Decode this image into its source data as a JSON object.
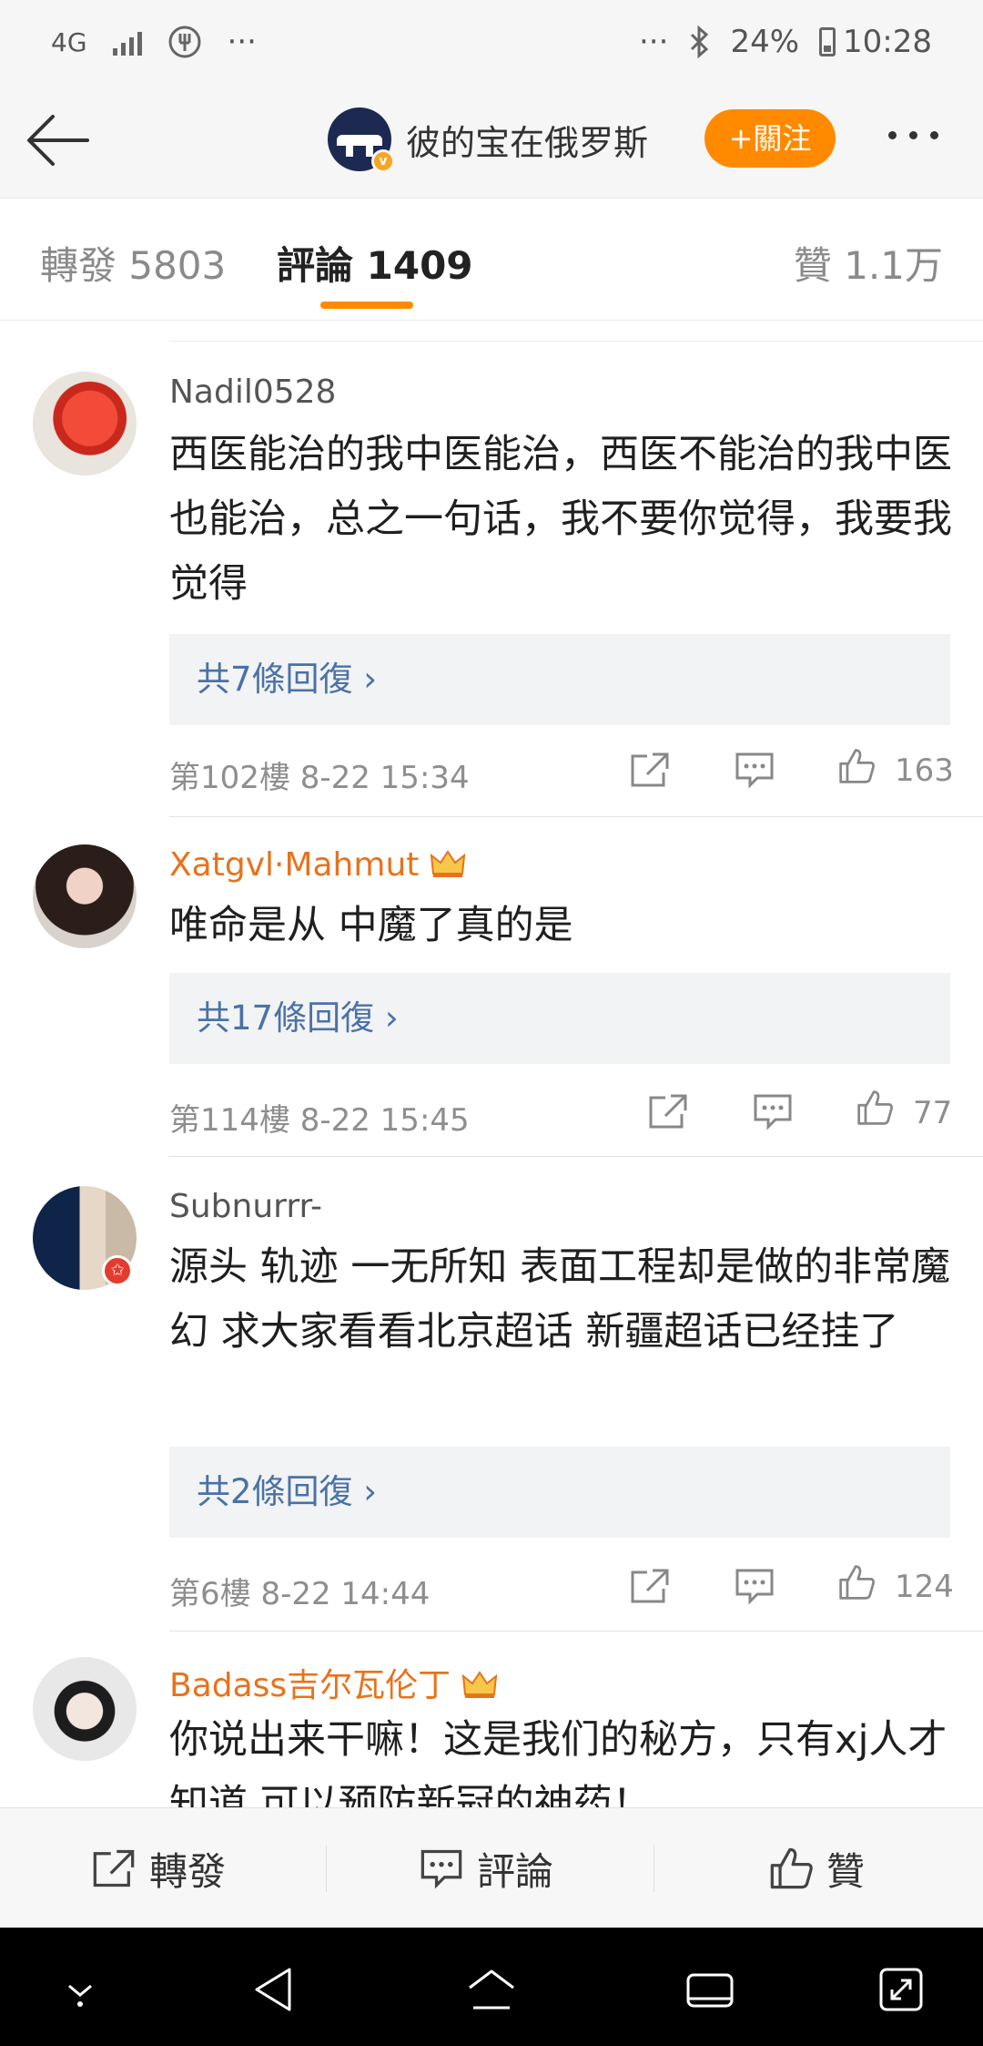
{
  "status_bar": {
    "network": "4G",
    "more": "···",
    "more_right": "···",
    "battery": "24%",
    "time": "10:28"
  },
  "header": {
    "username": "彼的宝在俄罗斯",
    "follow_label": "+關注"
  },
  "tabs": {
    "repost": "轉發 5803",
    "comments": "評論 1409",
    "likes": "贊 1.1万"
  },
  "comments": [
    {
      "user": "Nadil0528",
      "text": "西医能治的我中医能治，西医不能治的我中医也能治，总之一句话，我不要你觉得，我要我觉得",
      "replies": "共7條回復 ›",
      "meta": "第102樓 8-22 15:34",
      "likes": "163"
    },
    {
      "user": "Xatgvl·Mahmut",
      "text": "唯命是从 中魔了真的是",
      "replies": "共17條回復 ›",
      "meta": "第114樓 8-22 15:45",
      "likes": "77"
    },
    {
      "user": "Subnurrr-",
      "text": "源头 轨迹 一无所知 表面工程却是做的非常魔幻 求大家看看北京超话 新疆超话已经挂了",
      "replies": "共2條回復 ›",
      "meta": "第6樓 8-22 14:44",
      "likes": "124"
    },
    {
      "user": "Badass吉尔瓦伦丁",
      "text": "你说出来干嘛！这是我们的秘方，只有xj人才知道 可以预防新冠的神药！"
    }
  ],
  "bottom_bar": {
    "repost": "轉發",
    "comment": "評論",
    "like": "贊"
  },
  "colors": {
    "accent": "#ff8a00",
    "reply_link": "#4a72a6",
    "vip_name": "#e8721c"
  },
  "icons": [
    "back-arrow-icon",
    "more-dots-icon",
    "share-icon",
    "comment-icon",
    "like-icon",
    "nav-down-icon",
    "nav-back-icon",
    "nav-home-icon",
    "nav-recents-icon",
    "nav-expand-icon"
  ]
}
